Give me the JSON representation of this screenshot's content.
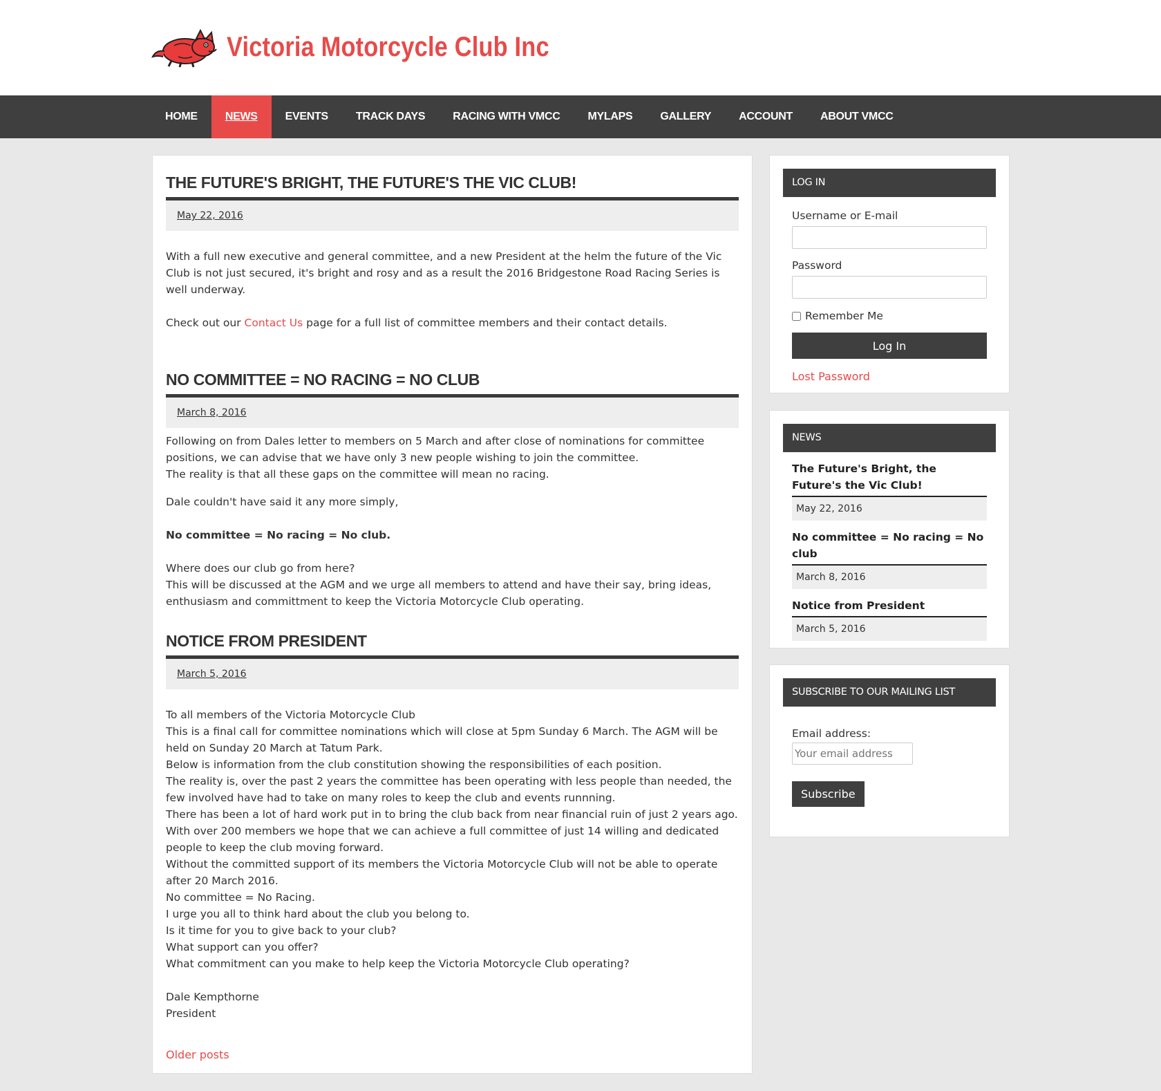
{
  "site": {
    "title": "Victoria Motorcycle Club Inc",
    "accent_color": "#e84a4a",
    "nav_color": "#3f3f3f"
  },
  "nav": {
    "items": [
      {
        "label": "HOME",
        "active": false
      },
      {
        "label": "NEWS",
        "active": true
      },
      {
        "label": "EVENTS",
        "active": false
      },
      {
        "label": "TRACK DAYS",
        "active": false
      },
      {
        "label": "RACING WITH VMCC",
        "active": false
      },
      {
        "label": "MYLAPS",
        "active": false
      },
      {
        "label": "GALLERY",
        "active": false
      },
      {
        "label": "ACCOUNT",
        "active": false
      },
      {
        "label": "ABOUT VMCC",
        "active": false
      }
    ]
  },
  "posts": [
    {
      "title": "THE FUTURE'S BRIGHT, THE FUTURE'S THE VIC CLUB!",
      "date": "May 22, 2016",
      "p1": "With a full new executive and general committee, and a new President at the helm the future of the Vic Club is not just secured, it's bright and rosy and as a result the 2016 Bridgestone Road Racing Series is well underway.",
      "p2_before": "Check out our ",
      "p2_link": "Contact Us",
      "p2_after": " page for a full list of committee members and their contact details."
    },
    {
      "title": "NO COMMITTEE = NO RACING = NO CLUB",
      "date": "March 8, 2016",
      "p1_line1": "Following on from Dales letter to members on 5 March and after close of nominations for committee positions, we can advise that we have only 3 new people wishing to join the committee.",
      "p1_line2": "The reality is that all these gaps on the committee will mean no racing.",
      "p2": "Dale couldn't have said it any more simply,",
      "p3": "No committee = No racing = No club.",
      "p4_line1": "Where does our club go from here?",
      "p4_line2": "This will be discussed at the AGM and we urge all members to attend and have their say, bring ideas, enthusiasm and committment to keep the Victoria Motorcycle Club operating."
    },
    {
      "title": "NOTICE FROM PRESIDENT",
      "date": "March 5, 2016",
      "lines": [
        "To all members of the Victoria Motorcycle Club",
        "This is a final call for committee nominations which will close at 5pm Sunday 6 March. The AGM will be held on Sunday 20 March at Tatum Park.",
        "Below is information from the club constitution showing the responsibilities of each position.",
        "The reality is, over the past 2 years the committee has been operating with less people than needed, the few involved have had to take on many roles to keep the club and events runnning.",
        "There has been a lot of hard work put in to bring the club back from near financial ruin of just 2 years ago.",
        "With over 200 members we hope that we can achieve a full committee of just 14 willing and dedicated people to keep the club moving forward.",
        "Without the committed support of its members the Victoria Motorcycle Club will not be able to operate after 20 March 2016.",
        "No committee = No Racing.",
        "I urge you all to think hard about the club you belong to.",
        "Is it time for you to give back to your club?",
        "What support can you offer?",
        "What commitment can you make to help keep the Victoria Motorcycle Club operating?"
      ],
      "sign_name": "Dale Kempthorne",
      "sign_role": "President"
    }
  ],
  "older_posts": "Older posts",
  "login": {
    "heading": "LOG IN",
    "username_label": "Username or E-mail",
    "username_value": "",
    "password_label": "Password",
    "password_value": "",
    "remember_label": "Remember Me",
    "remember_checked": false,
    "button": "Log In",
    "lost": "Lost Password"
  },
  "news_widget": {
    "heading": "NEWS",
    "items": [
      {
        "title": "The Future's Bright, the Future's the Vic Club!",
        "date": "May 22, 2016"
      },
      {
        "title": "No committee = No racing = No club",
        "date": "March 8, 2016"
      },
      {
        "title": "Notice from President",
        "date": "March 5, 2016"
      }
    ]
  },
  "subscribe": {
    "heading": "SUBSCRIBE TO OUR MAILING LIST",
    "email_label": "Email address:",
    "email_placeholder": "Your email address",
    "email_value": "",
    "button": "Subscribe"
  }
}
